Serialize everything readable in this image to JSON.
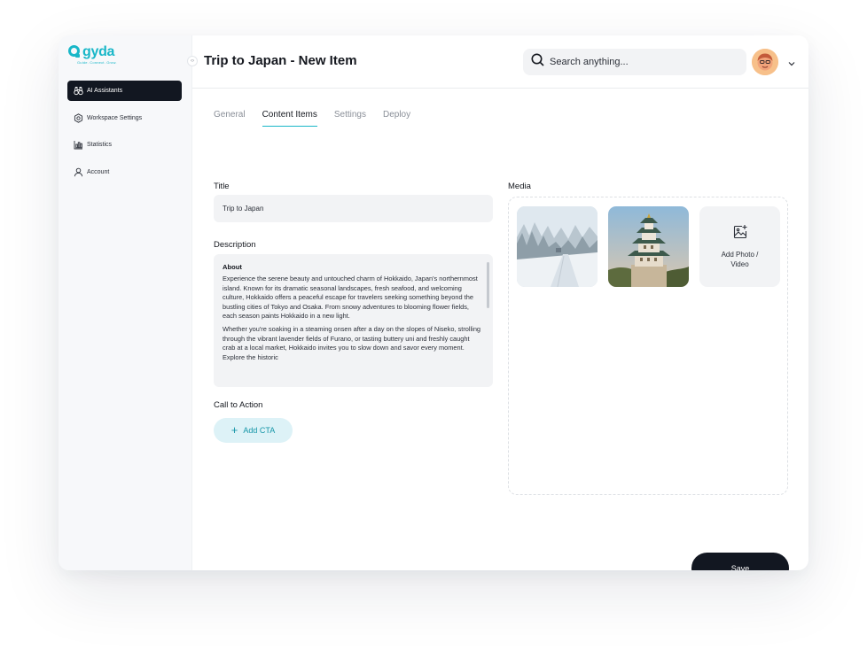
{
  "brand": {
    "name": "gyda",
    "tagline": "Guide. Connect. Grow.",
    "accent": "#19b7c8"
  },
  "sidebar": {
    "items": [
      {
        "label": "AI Assistants",
        "icon": "binoculars-icon",
        "active": true
      },
      {
        "label": "Workspace Settings",
        "icon": "gear-icon",
        "active": false
      },
      {
        "label": "Statistics",
        "icon": "bar-chart-icon",
        "active": false
      },
      {
        "label": "Account",
        "icon": "user-icon",
        "active": false
      }
    ]
  },
  "header": {
    "title": "Trip to Japan - New Item",
    "search_placeholder": "Search anything..."
  },
  "tabs": [
    {
      "label": "General",
      "active": false
    },
    {
      "label": "Content Items",
      "active": true
    },
    {
      "label": "Settings",
      "active": false
    },
    {
      "label": "Deploy",
      "active": false
    }
  ],
  "form": {
    "title_label": "Title",
    "title_value": "Trip to Japan",
    "description_label": "Description",
    "description_heading": "About",
    "description_paragraphs": [
      "Experience the serene beauty and untouched charm of Hokkaido, Japan's northernmost island. Known for its dramatic seasonal landscapes, fresh seafood, and welcoming culture, Hokkaido offers a peaceful escape for travelers seeking something beyond the bustling cities of Tokyo and Osaka. From snowy adventures to blooming flower fields, each season paints Hokkaido in a new light.",
      "Whether you're soaking in a steaming onsen after a day on the slopes of Niseko, strolling through the vibrant lavender fields of Furano, or tasting buttery uni and freshly caught crab at a local market, Hokkaido invites you to slow down and savor every moment. Explore the historic"
    ],
    "cta_label": "Call to Action",
    "add_cta": "Add CTA",
    "media_label": "Media",
    "add_media": "Add Photo / Video",
    "save": "Save"
  }
}
